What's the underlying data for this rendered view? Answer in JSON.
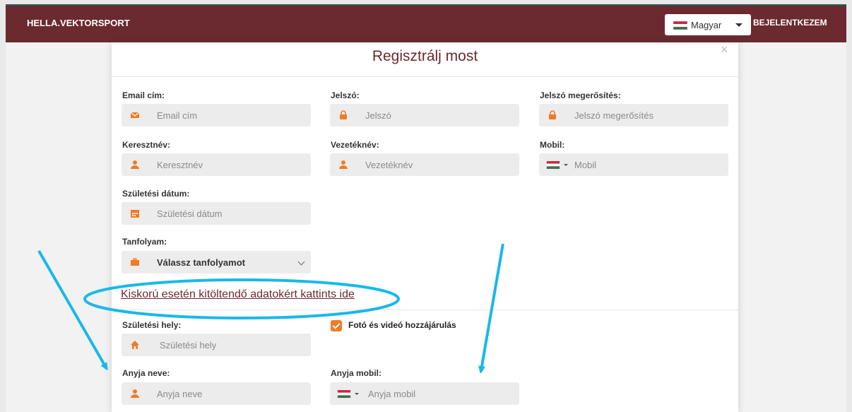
{
  "header": {
    "brand": "HELLA.VEKTORSPORT",
    "language": "Magyar",
    "login_label": "BEJELENTKEZEM"
  },
  "modal": {
    "title": "Regisztrálj most",
    "close_label": "×",
    "fields": {
      "email": {
        "label": "Email cím:",
        "placeholder": "Email cím",
        "icon": "envelope-icon"
      },
      "password": {
        "label": "Jelszó:",
        "placeholder": "Jelszó",
        "icon": "lock-icon"
      },
      "password_confirm": {
        "label": "Jelszó megerősítés:",
        "placeholder": "Jelszó megerősítés",
        "icon": "lock-icon"
      },
      "first_name": {
        "label": "Keresztnév:",
        "placeholder": "Keresztnév",
        "icon": "user-icon"
      },
      "last_name": {
        "label": "Vezetéknév:",
        "placeholder": "Vezetéknév",
        "icon": "user-icon"
      },
      "mobile": {
        "label": "Mobil:",
        "placeholder": "Mobil",
        "icon": "hungarian-flag-icon"
      },
      "birth_date": {
        "label": "Születési dátum:",
        "placeholder": "Születési dátum",
        "icon": "calendar-icon"
      },
      "course": {
        "label": "Tanfolyam:",
        "value": "Válassz tanfolyamot",
        "icon": "briefcase-icon"
      },
      "birth_place": {
        "label": "Születési hely:",
        "placeholder": "Születési hely",
        "icon": "home-icon"
      },
      "mother_name": {
        "label": "Anyja neve:",
        "placeholder": "Anyja neve",
        "icon": "user-icon"
      },
      "mother_mobile": {
        "label": "Anyja mobil:",
        "placeholder": "Anyja mobil",
        "icon": "hungarian-flag-icon"
      }
    },
    "minor_link": "Kiskorú esetén kitöltendő adatokért kattints ide",
    "consent_label": "Fotó és videó hozzájárulás",
    "consent_checked": true
  },
  "colors": {
    "brand": "#6b2a2f",
    "icon_orange": "#f07b22",
    "annotation": "#1ab8ea"
  }
}
